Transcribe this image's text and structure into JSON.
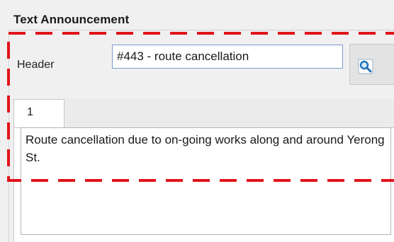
{
  "group": {
    "title": "Text Announcement"
  },
  "header_field": {
    "label": "Header",
    "value": "#443 - route cancellation"
  },
  "search_button": {
    "icon": "magnifier-search-icon"
  },
  "tabs": [
    {
      "label": "1",
      "selected": true
    }
  ],
  "body": {
    "text": "Route cancellation due to on-going works along and around Yerong St."
  },
  "annotation": {
    "color": "#e0141a",
    "style": "dashed"
  }
}
